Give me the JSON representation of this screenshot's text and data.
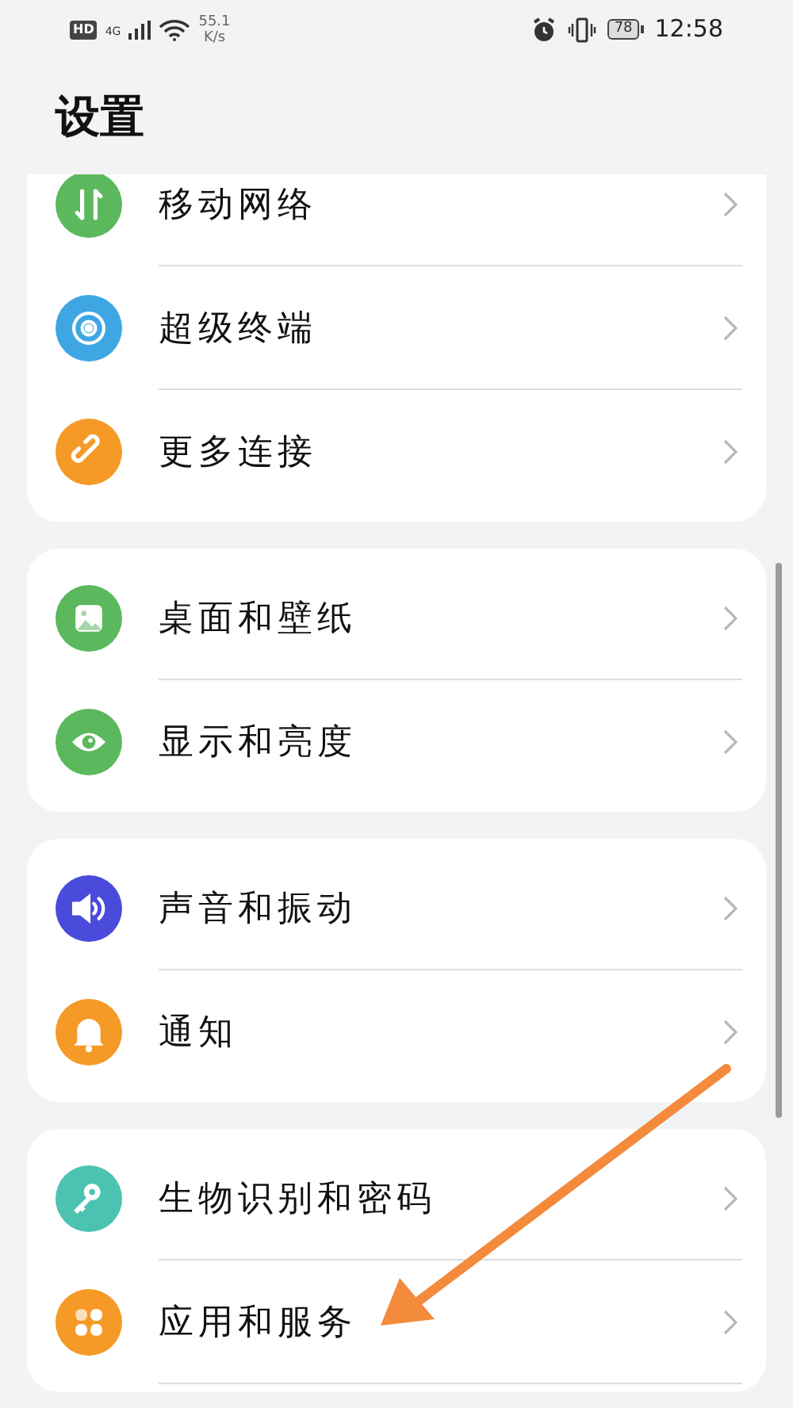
{
  "status_bar": {
    "hd": "HD",
    "network": "4G",
    "speed": "55.1",
    "speed_unit": "K/s",
    "battery": "78",
    "time": "12:58"
  },
  "title": "设置",
  "groups": [
    {
      "items": [
        {
          "label": "移动网络",
          "kind": "data",
          "color": "#5cb85c"
        },
        {
          "label": "超级终端",
          "kind": "devices",
          "color": "#3ea7e3"
        },
        {
          "label": "更多连接",
          "kind": "link",
          "color": "#f59a26"
        }
      ]
    },
    {
      "items": [
        {
          "label": "桌面和壁纸",
          "kind": "wallpaper",
          "color": "#5cb85c"
        },
        {
          "label": "显示和亮度",
          "kind": "eye",
          "color": "#5cb85c"
        }
      ]
    },
    {
      "items": [
        {
          "label": "声音和振动",
          "kind": "sound",
          "color": "#4b4bdb"
        },
        {
          "label": "通知",
          "kind": "bell",
          "color": "#f59a26"
        }
      ]
    },
    {
      "items": [
        {
          "label": "生物识别和密码",
          "kind": "key",
          "color": "#4cc3b0"
        },
        {
          "label": "应用和服务",
          "kind": "apps",
          "color": "#f59a26"
        }
      ]
    }
  ]
}
